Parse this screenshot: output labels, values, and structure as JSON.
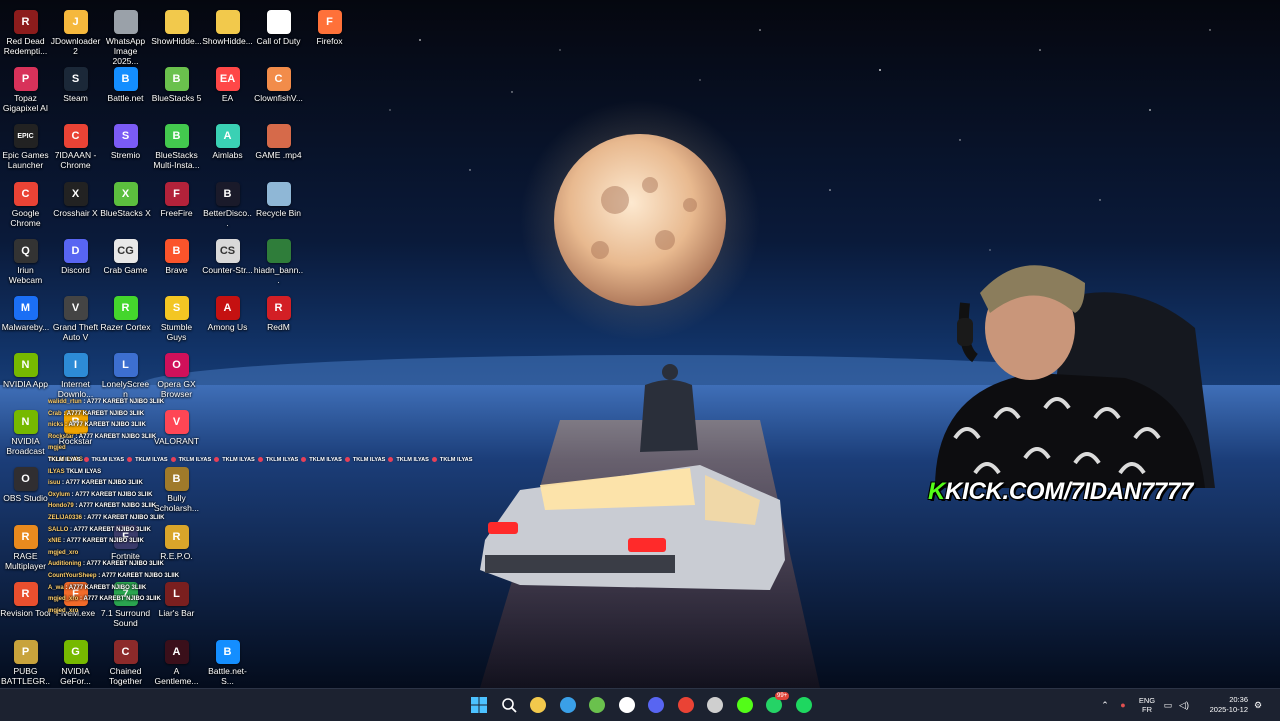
{
  "desktop": {
    "icons": [
      {
        "label": "Red Dead Redempti...",
        "icon": "rdr-icon",
        "color": "#8c1c1c",
        "glyph": "R"
      },
      {
        "label": "JDownloader 2",
        "icon": "jdownloader-icon",
        "color": "#f5b83d",
        "glyph": "J"
      },
      {
        "label": "WhatsApp Image 2025...",
        "icon": "image-file-icon",
        "color": "#9aa1a9",
        "glyph": ""
      },
      {
        "label": "ShowHidde...",
        "icon": "folder-icon",
        "color": "#f2c94c",
        "glyph": ""
      },
      {
        "label": "ShowHidde...",
        "icon": "folder-icon",
        "color": "#f2c94c",
        "glyph": ""
      },
      {
        "label": "Call of Duty",
        "icon": "file-icon",
        "color": "#ffffff",
        "glyph": ""
      },
      {
        "label": "Firefox",
        "icon": "firefox-icon",
        "color": "#ff7139",
        "glyph": "F"
      },
      {
        "label": "Topaz Gigapixel AI",
        "icon": "topaz-icon",
        "color": "#d8325a",
        "glyph": "P"
      },
      {
        "label": "Steam",
        "icon": "steam-icon",
        "color": "#1b2838",
        "glyph": "S"
      },
      {
        "label": "Battle.net",
        "icon": "battlenet-icon",
        "color": "#148eff",
        "glyph": "B"
      },
      {
        "label": "BlueStacks 5",
        "icon": "bluestacks-icon",
        "color": "#6ac14d",
        "glyph": "B"
      },
      {
        "label": "EA",
        "icon": "ea-icon",
        "color": "#ff4747",
        "glyph": "EA"
      },
      {
        "label": "ClownfishV...",
        "icon": "clownfish-icon",
        "color": "#f28c4a",
        "glyph": "C"
      },
      {
        "label": "Epic Games Launcher",
        "icon": "epic-games-icon",
        "color": "#222222",
        "glyph": "EPIC"
      },
      {
        "label": "7IDAAAN - Chrome",
        "icon": "chrome-icon",
        "color": "#ea4335",
        "glyph": "C"
      },
      {
        "label": "Stremio",
        "icon": "stremio-icon",
        "color": "#7b5bf5",
        "glyph": "S"
      },
      {
        "label": "BlueStacks Multi-Insta...",
        "icon": "bluestacks-multi-icon",
        "color": "#43c94e",
        "glyph": "B"
      },
      {
        "label": "Aimlabs",
        "icon": "aimlabs-icon",
        "color": "#3ad1b4",
        "glyph": "A"
      },
      {
        "label": "GAME .mp4",
        "icon": "video-file-icon",
        "color": "#d66a4a",
        "glyph": ""
      },
      {
        "label": "Google Chrome",
        "icon": "chrome-icon",
        "color": "#ea4335",
        "glyph": "C"
      },
      {
        "label": "Crosshair X",
        "icon": "crosshair-icon",
        "color": "#222222",
        "glyph": "X"
      },
      {
        "label": "BlueStacks X",
        "icon": "bluestacks-x-icon",
        "color": "#5cbf3e",
        "glyph": "X"
      },
      {
        "label": "FreeFire",
        "icon": "freefire-icon",
        "color": "#b3223a",
        "glyph": "F"
      },
      {
        "label": "BetterDisco...",
        "icon": "betterdiscord-icon",
        "color": "#1a1a2a",
        "glyph": "B"
      },
      {
        "label": "Recycle Bin",
        "icon": "recycle-bin-icon",
        "color": "#8fb7d6",
        "glyph": ""
      },
      {
        "label": "Iriun Webcam",
        "icon": "iriun-icon",
        "color": "#333333",
        "glyph": "Q"
      },
      {
        "label": "Discord",
        "icon": "discord-icon",
        "color": "#5865f2",
        "glyph": "D"
      },
      {
        "label": "Crab Game",
        "icon": "crab-game-icon",
        "color": "#e8e8e8",
        "glyph": "CG"
      },
      {
        "label": "Brave",
        "icon": "brave-icon",
        "color": "#fb542b",
        "glyph": "B"
      },
      {
        "label": "Counter-Str...",
        "icon": "counter-strike-icon",
        "color": "#d9d9d9",
        "glyph": "CS"
      },
      {
        "label": "hiadn_bann...",
        "icon": "file-icon",
        "color": "#2f7d3a",
        "glyph": ""
      },
      {
        "label": "Malwareby...",
        "icon": "malwarebytes-icon",
        "color": "#1b6ff5",
        "glyph": "M"
      },
      {
        "label": "Grand Theft Auto V",
        "icon": "gta-icon",
        "color": "#444444",
        "glyph": "V"
      },
      {
        "label": "Razer Cortex",
        "icon": "razer-icon",
        "color": "#44d62c",
        "glyph": "R"
      },
      {
        "label": "Stumble Guys",
        "icon": "stumble-guys-icon",
        "color": "#f3c623",
        "glyph": "S"
      },
      {
        "label": "Among Us",
        "icon": "among-us-icon",
        "color": "#c51111",
        "glyph": "A"
      },
      {
        "label": "RedM",
        "icon": "redm-icon",
        "color": "#d31f25",
        "glyph": "R"
      },
      {
        "label": "NVIDIA App",
        "icon": "nvidia-icon",
        "color": "#76b900",
        "glyph": "N"
      },
      {
        "label": "Internet Downlo...",
        "icon": "idm-icon",
        "color": "#2d8bd6",
        "glyph": "I"
      },
      {
        "label": "LonelyScreen",
        "icon": "lonelyscreen-icon",
        "color": "#3d6fd0",
        "glyph": "L"
      },
      {
        "label": "Opera GX Browser",
        "icon": "opera-gx-icon",
        "color": "#d0105a",
        "glyph": "O"
      },
      {
        "label": "NVIDIA Broadcast",
        "icon": "nvidia-broadcast-icon",
        "color": "#76b900",
        "glyph": "N"
      },
      {
        "label": "Rockstar",
        "icon": "rockstar-icon",
        "color": "#f0a400",
        "glyph": "R"
      },
      {
        "label": "VALORANT",
        "icon": "valorant-icon",
        "color": "#ff4655",
        "glyph": "V"
      },
      {
        "label": "OBS Studio",
        "icon": "obs-icon",
        "color": "#302e31",
        "glyph": "O"
      },
      {
        "label": "Bully Scholarsh...",
        "icon": "bully-icon",
        "color": "#a07a2a",
        "glyph": "B"
      },
      {
        "label": "RAGE Multiplayer",
        "icon": "rage-mp-icon",
        "color": "#e98a1e",
        "glyph": "R"
      },
      {
        "label": "Fortnite",
        "icon": "fortnite-icon",
        "color": "#3a3a6a",
        "glyph": "F"
      },
      {
        "label": "R.E.P.O.",
        "icon": "repo-icon",
        "color": "#d9a52a",
        "glyph": "R"
      },
      {
        "label": "Revision Tool",
        "icon": "revision-tool-icon",
        "color": "#e94f2e",
        "glyph": "R"
      },
      {
        "label": "FiveM.exe",
        "icon": "fivem-icon",
        "color": "#f26b2a",
        "glyph": "F"
      },
      {
        "label": "7.1 Surround Sound",
        "icon": "surround-icon",
        "color": "#2aa44f",
        "glyph": "7"
      },
      {
        "label": "Liar's Bar",
        "icon": "liars-bar-icon",
        "color": "#7a1f1f",
        "glyph": "L"
      },
      {
        "label": "PUBG BATTLEGR...",
        "icon": "pubg-icon",
        "color": "#c8a33c",
        "glyph": "P"
      },
      {
        "label": "NVIDIA GeFor...",
        "icon": "geforce-icon",
        "color": "#76b900",
        "glyph": "G"
      },
      {
        "label": "Chained Together",
        "icon": "chained-together-icon",
        "color": "#8c2a2a",
        "glyph": "C"
      },
      {
        "label": "A Gentleme...",
        "icon": "gentleman-icon",
        "color": "#3a0f1a",
        "glyph": "A"
      },
      {
        "label": "Battle.net-S...",
        "icon": "battlenet-icon",
        "color": "#148eff",
        "glyph": "B"
      }
    ]
  },
  "chat": {
    "messages": [
      {
        "user": "walidd_rtun",
        "text": ": A777 KAREBT NJIBO 3LIIK"
      },
      {
        "user": "Crab",
        "text": ": A777 KAREBT NJIBO 3LIIK"
      },
      {
        "user": "nicks",
        "text": ": A777 KAREBT NJIBO 3LIIK"
      },
      {
        "user": "Rockstar",
        "text": ": A777 KAREBT NJIBO 3LIIK"
      },
      {
        "user": "mgjed",
        "text": ""
      },
      {
        "user": "TKLM ILYAS",
        "text": ""
      },
      {
        "user": "ILYAS",
        "text": "TKLM ILYAS"
      },
      {
        "user": "isuu",
        "text": ": A777 KAREBT NJIBO 3LIIK"
      },
      {
        "user": "Oxylum",
        "text": ": A777 KAREBT NJIBO 3LIIK"
      },
      {
        "user": "Hondo79",
        "text": ": A777 KAREBT NJIBO 3LIIK"
      },
      {
        "user": "ZELIJA0336",
        "text": ": A777 KAREBT NJIBO 3LIIK"
      },
      {
        "user": "SALLO",
        "text": ": A777 KAREBT NJIBO 3LIIK"
      },
      {
        "user": "xNIE",
        "text": ": A777 KAREBT NJIBO 3LIIK"
      },
      {
        "user": "mgjed_xro",
        "text": ""
      },
      {
        "user": "Auditioning",
        "text": ": A777 KAREBT NJIBO 3LIIK"
      },
      {
        "user": "CountYourSheep",
        "text": ": A777 KAREBT NJIBO 3LIIK"
      },
      {
        "user": "A_wa",
        "text": ": A777 KAREBT NJIBO 3LIIK"
      },
      {
        "user": "mgjed_xro",
        "text": ": A777 KAREBT NJIBO 3LIIK"
      },
      {
        "user": "mgjed_xro",
        "text": ""
      }
    ],
    "spam_line": "TKLM ILYAS"
  },
  "stream": {
    "kick_url": "KICK.COM/7IDAN7777",
    "kick_logo": "K"
  },
  "taskbar": {
    "apps": [
      {
        "name": "start-button",
        "glyph": "",
        "color": "#3a9bf0"
      },
      {
        "name": "search-icon",
        "glyph": "",
        "color": "#ffffff"
      },
      {
        "name": "file-explorer-icon",
        "glyph": "",
        "color": "#f2c94c"
      },
      {
        "name": "microsoft-store-icon",
        "glyph": "",
        "color": "#3aa0e8"
      },
      {
        "name": "bluestacks-taskbar-icon",
        "glyph": "",
        "color": "#6ac14d"
      },
      {
        "name": "obs-taskbar-icon",
        "glyph": "",
        "color": "#ffffff"
      },
      {
        "name": "discord-taskbar-icon",
        "glyph": "",
        "color": "#5865f2"
      },
      {
        "name": "chrome-taskbar-icon",
        "glyph": "",
        "color": "#ea4335"
      },
      {
        "name": "crosshair-taskbar-icon",
        "glyph": "",
        "color": "#cfcfcf"
      },
      {
        "name": "kick-taskbar-icon",
        "glyph": "",
        "color": "#53fc18"
      },
      {
        "name": "whatsapp-taskbar-icon",
        "glyph": "",
        "color": "#25d366"
      },
      {
        "name": "spotify-taskbar-icon",
        "glyph": "",
        "color": "#1ed760"
      }
    ],
    "whatsapp_badge": "99+",
    "language_top": "ENG",
    "language_bottom": "FR",
    "time": "20:36",
    "date": "2025-10-12"
  }
}
